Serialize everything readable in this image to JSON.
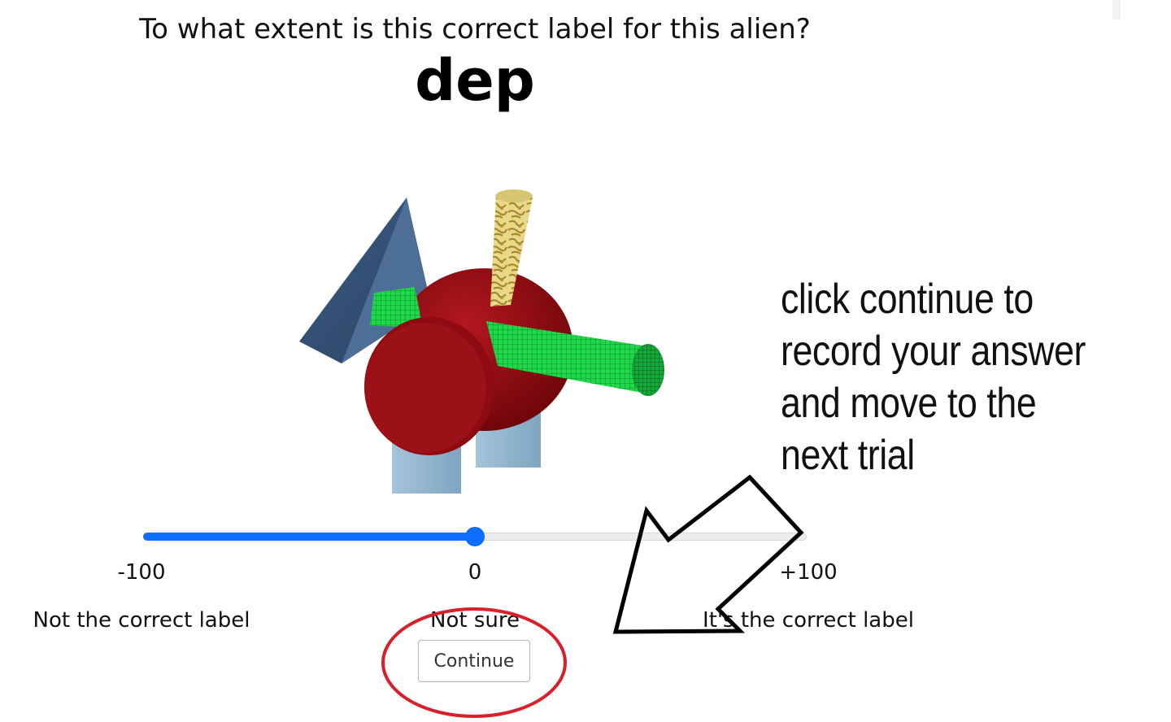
{
  "question": "To what extent is this correct label for this alien?",
  "label_word": "dep",
  "slider": {
    "min": -100,
    "max": 100,
    "value": 0,
    "accent_color": "#0d6efd"
  },
  "scale_ticks": {
    "min_label": "-100",
    "mid_label": "0",
    "max_label": "+100"
  },
  "scale_anchors": {
    "left": "Not the correct label",
    "middle": "Not sure",
    "right": "It's the correct label"
  },
  "continue_button": {
    "label": "Continue"
  },
  "annotation": {
    "lines": [
      "click continue to",
      "record your answer",
      "and move to the",
      "next trial"
    ],
    "circle_color": "#d9202a"
  }
}
